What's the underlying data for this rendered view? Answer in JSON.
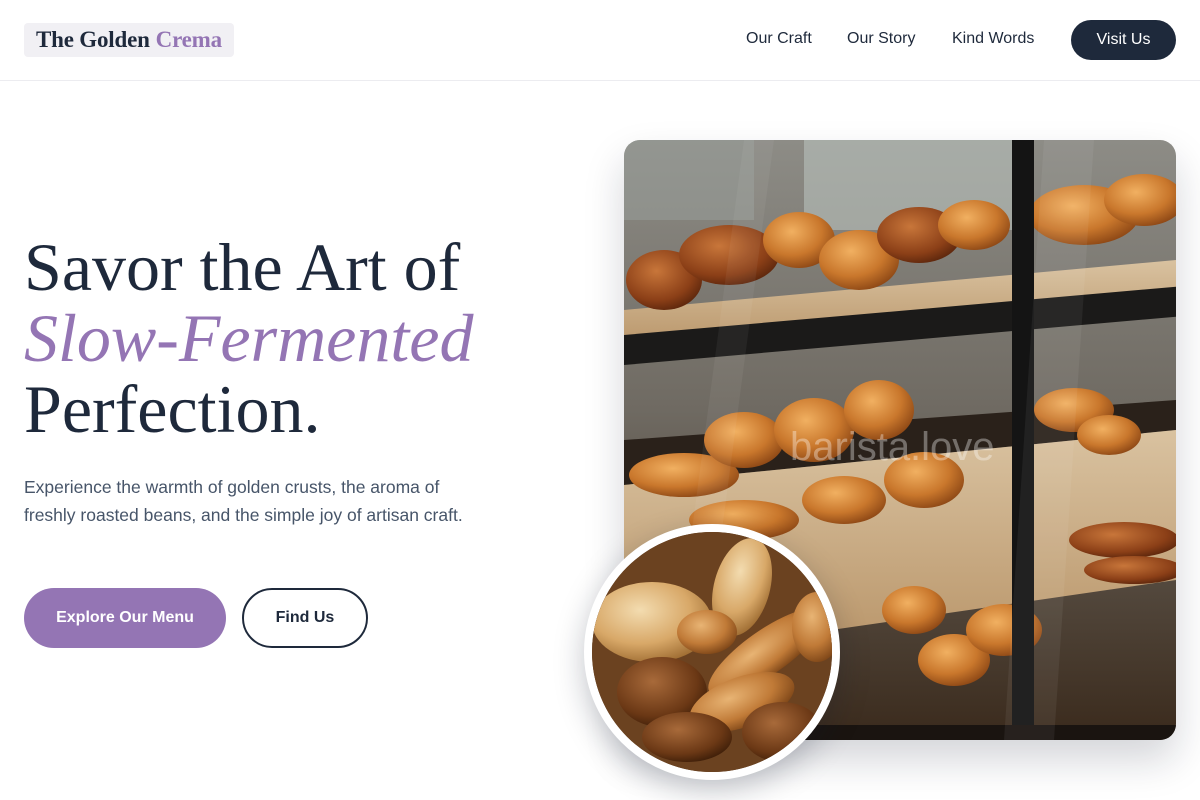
{
  "brand": {
    "name_main": "The Golden",
    "name_accent": "Crema"
  },
  "nav": {
    "links": [
      {
        "label": "Our Craft"
      },
      {
        "label": "Our Story"
      },
      {
        "label": "Kind Words"
      }
    ],
    "cta": "Visit Us"
  },
  "hero": {
    "headline_line1": "Savor the Art of",
    "headline_accent": "Slow-Fermented",
    "headline_line3": "Perfection.",
    "subtext": "Experience the warmth of golden crusts, the aroma of freshly roasted beans, and the simple joy of artisan craft.",
    "primary_button": "Explore Our Menu",
    "secondary_button": "Find Us",
    "watermark": "barista.love"
  },
  "colors": {
    "accent": "#9475b4",
    "dark": "#1e293b",
    "text_muted": "#475569"
  },
  "icons": {
    "hero_image": "bakery-display-case-photo",
    "inset_image": "bread-basket-photo"
  }
}
